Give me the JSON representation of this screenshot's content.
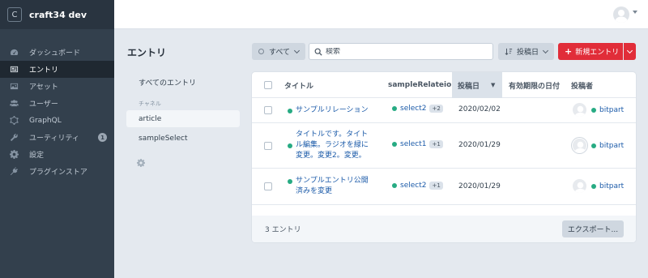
{
  "sidebar": {
    "site_initial": "C",
    "site_name": "craft34 dev",
    "items": [
      {
        "label": "ダッシュボード",
        "icon": "gauge-icon",
        "active": false
      },
      {
        "label": "エントリ",
        "icon": "newspaper-icon",
        "active": true
      },
      {
        "label": "アセット",
        "icon": "image-icon",
        "active": false
      },
      {
        "label": "ユーザー",
        "icon": "users-icon",
        "active": false
      },
      {
        "label": "GraphQL",
        "icon": "graphql-icon",
        "active": false
      },
      {
        "label": "ユーティリティ",
        "icon": "wrench-icon",
        "active": false,
        "badge": "1"
      },
      {
        "label": "設定",
        "icon": "gear-icon",
        "active": false
      },
      {
        "label": "プラグインストア",
        "icon": "plug-icon",
        "active": false
      }
    ]
  },
  "header": {
    "user_avatar": "user-avatar"
  },
  "main": {
    "title": "エントリ",
    "status_filter": "すべて",
    "search_placeholder": "検索",
    "sort_label": "投稿日",
    "new_entry_label": "新規エントリ",
    "sources": {
      "all": "すべてのエントリ",
      "heading": "チャネル",
      "items": [
        "article",
        "sampleSelect"
      ],
      "active": "article"
    }
  },
  "table": {
    "columns": [
      "タイトル",
      "sampleRelateion",
      "投稿日",
      "有効期限の日付",
      "投稿者"
    ],
    "sorted_column": "投稿日",
    "rows": [
      {
        "title": "サンプルリレーション",
        "relation": "select2",
        "more": "+2",
        "date": "2020/02/02",
        "author": "bitpart"
      },
      {
        "title_lines": [
          "タイトルです。タイト",
          "ル編集。ラジオを緑に",
          "変更。変更2。変更。"
        ],
        "relation": "select1",
        "more": "+1",
        "date": "2020/01/29",
        "author": "bitpart"
      },
      {
        "title_lines": [
          "サンプルエントリ公開",
          "済みを変更"
        ],
        "relation": "select2",
        "more": "+1",
        "date": "2020/01/29",
        "author": "bitpart"
      }
    ],
    "count_label": "3 エントリ",
    "export_label": "エクスポート..."
  },
  "colors": {
    "accent": "#e12d39",
    "link": "#1c5ba9",
    "status_live": "#27ab83",
    "sidebar": "#33404d"
  }
}
